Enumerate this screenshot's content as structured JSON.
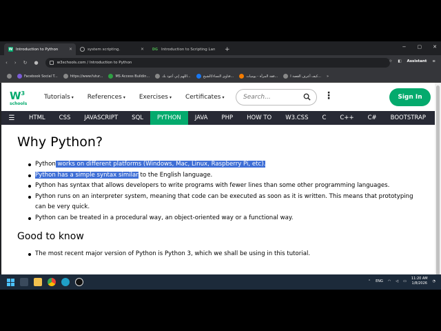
{
  "browser": {
    "tabs": [
      {
        "label": "Introduction to Python",
        "active": true,
        "favicon": "W"
      },
      {
        "label": "system scripting.",
        "active": false,
        "favicon": "web"
      },
      {
        "label": "Introduction to Scripting Lan",
        "active": false,
        "favicon": "DG"
      }
    ],
    "new_tab": "+",
    "window_controls": [
      "−",
      "▢",
      "✕"
    ],
    "nav": [
      "‹",
      "›",
      "↻"
    ],
    "url": "w3schools.com / Introduction to Python",
    "assistant_label": "Assistant",
    "bookmarks": [
      "Facebook Social T...",
      "https://www.futur...",
      "MS Access Buildin...",
      "اللهم إني أعوذ بك...",
      "فتاوى النساء/الشيخ...",
      "فقة المرأة - يوميات...",
      "كيف أعرف القصة ا..."
    ],
    "bookmarks_more": "»"
  },
  "w3": {
    "logo_w3": "W",
    "logo_sup": "3",
    "logo_schools": "schools",
    "menu": [
      {
        "label": "Tutorials",
        "caret": "▾"
      },
      {
        "label": "References",
        "caret": "▾"
      },
      {
        "label": "Exercises",
        "caret": "▾"
      },
      {
        "label": "Certificates",
        "caret": "▾"
      }
    ],
    "search_placeholder": "Search...",
    "kebab": "⋮",
    "signin": "Sign In",
    "topnav": [
      "HTML",
      "CSS",
      "JAVASCRIPT",
      "SQL",
      "PYTHON",
      "JAVA",
      "PHP",
      "HOW TO",
      "W3.CSS",
      "C",
      "C++",
      "C#",
      "BOOTSTRAP"
    ],
    "topnav_active": "PYTHON",
    "hamburger": "☰"
  },
  "content": {
    "title": "Why Python?",
    "bullets": [
      {
        "pre": "Python",
        "hl": " works on different platforms (Windows, Mac, Linux, Raspberry Pi, etc).",
        "post": ""
      },
      {
        "pre": "",
        "hl": "Python has a simple syntax similar",
        "post": " to the English language."
      },
      {
        "pre": "Python has syntax that allows developers to write programs with fewer lines than some other programming languages.",
        "hl": "",
        "post": ""
      },
      {
        "pre": "Python runs on an interpreter system, meaning that code can be executed as soon as it is written. This means that prototyping can be very quick.",
        "hl": "",
        "post": ""
      },
      {
        "pre": "Python can be treated in a procedural way, an object-oriented way or a functional way.",
        "hl": "",
        "post": ""
      }
    ],
    "subtitle": "Good to know",
    "bullets2": [
      "The most recent major version of Python is Python 3, which we shall be using in this tutorial."
    ]
  },
  "taskbar": {
    "lang": "ENG",
    "time": "11:20 AM",
    "date": "1/8/2026"
  },
  "colors": {
    "w3_green": "#04aa6d",
    "topnav_bg": "#282a35",
    "selection": "#3f6fd6"
  }
}
